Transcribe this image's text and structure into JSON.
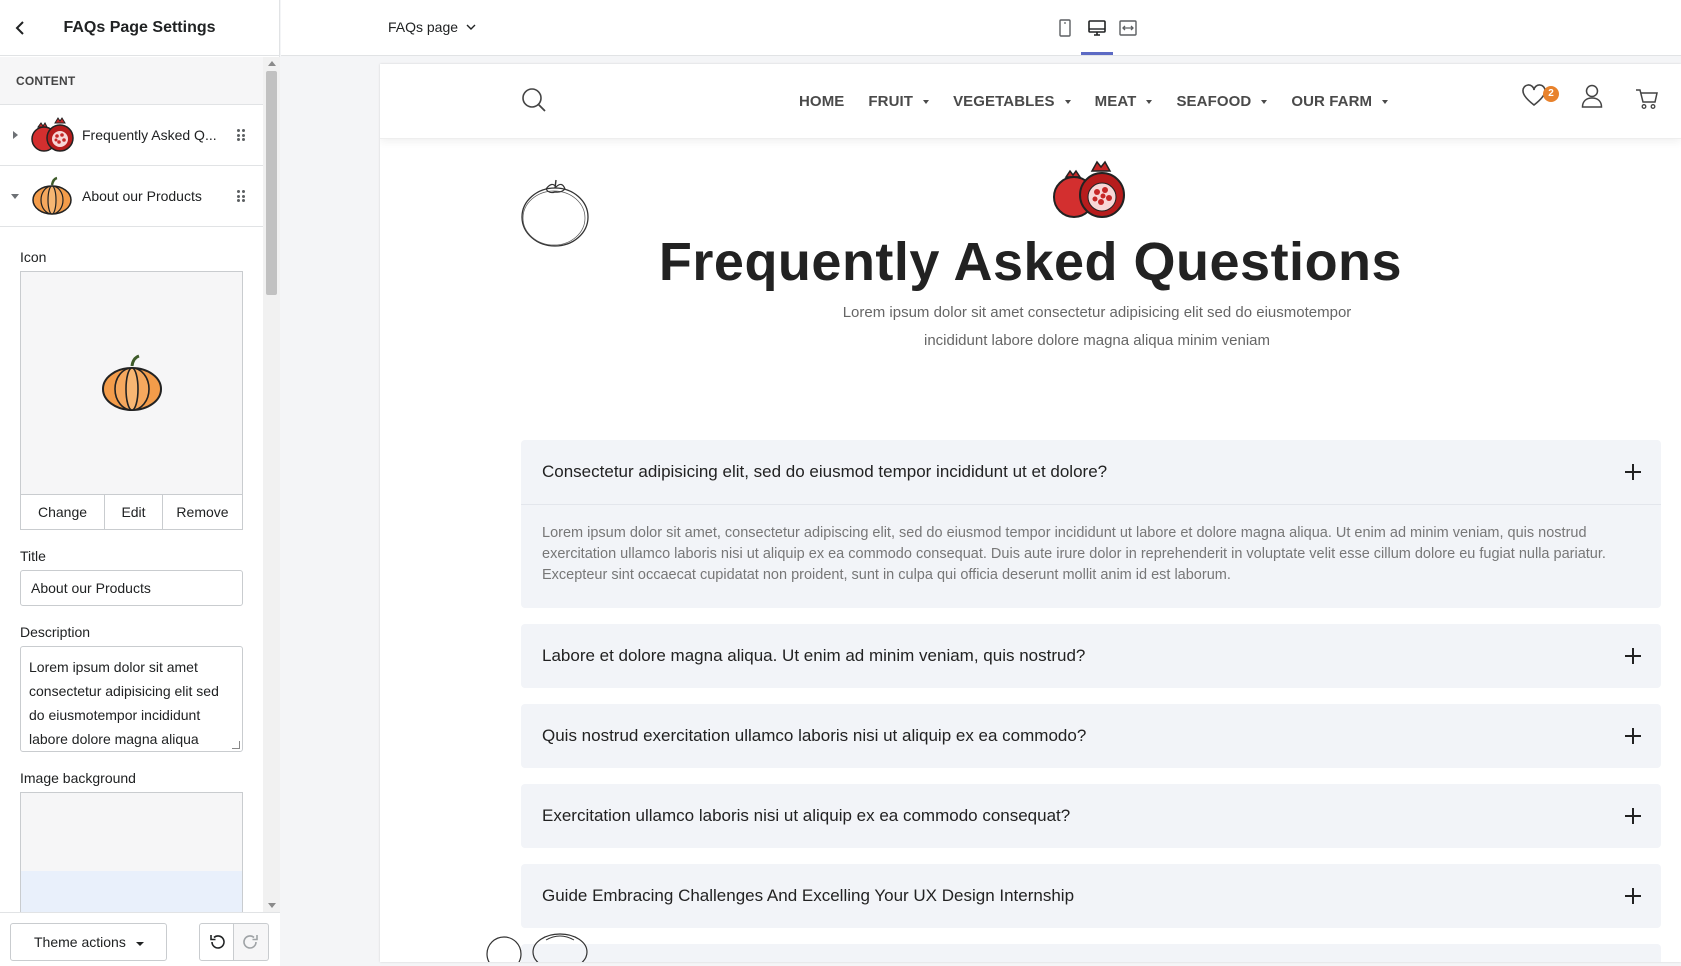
{
  "sidebar": {
    "title": "FAQs Page Settings",
    "section_label": "CONTENT",
    "blocks": [
      {
        "label": "Frequently Asked Q...",
        "icon": "pomegranate-icon",
        "expanded": false
      },
      {
        "label": "About our Products",
        "icon": "pumpkin-icon",
        "expanded": true
      }
    ],
    "icon_label": "Icon",
    "icon_actions": {
      "change": "Change",
      "edit": "Edit",
      "remove": "Remove"
    },
    "title_label": "Title",
    "title_value": "About our Products",
    "description_label": "Description",
    "description_value": "Lorem ipsum dolor sit amet consectetur adipisicing elit sed do eiusmotempor incididunt labore dolore magna aliqua",
    "image_bg_label": "Image background",
    "theme_actions_label": "Theme actions"
  },
  "topbar": {
    "page_selector": "FAQs page",
    "devices": [
      "mobile-icon",
      "desktop-icon",
      "fullwidth-icon"
    ],
    "active_device": "desktop-icon"
  },
  "store": {
    "nav": {
      "items": [
        {
          "label": "HOME",
          "dropdown": false
        },
        {
          "label": "FRUIT",
          "dropdown": true
        },
        {
          "label": "VEGETABLES",
          "dropdown": true
        },
        {
          "label": "MEAT",
          "dropdown": true
        },
        {
          "label": "SEAFOOD",
          "dropdown": true
        },
        {
          "label": "OUR FARM",
          "dropdown": true
        }
      ],
      "wishlist_count": "2"
    },
    "hero": {
      "title": "Frequently Asked Questions",
      "subtitle": "Lorem ipsum dolor sit amet consectetur adipisicing elit sed do eiusmotempor incididunt labore dolore magna aliqua minim veniam"
    },
    "faqs": [
      {
        "question": "Consectetur adipisicing elit, sed do eiusmod tempor incididunt ut et dolore?",
        "answer": "Lorem ipsum dolor sit amet, consectetur adipiscing elit, sed do eiusmod tempor incididunt ut labore et dolore magna aliqua. Ut enim ad minim veniam, quis nostrud exercitation ullamco laboris nisi ut aliquip ex ea commodo consequat. Duis aute irure dolor in reprehenderit in voluptate velit esse cillum dolore eu fugiat nulla pariatur. Excepteur sint occaecat cupidatat non proident, sunt in culpa qui officia deserunt mollit anim id est laborum.",
        "open": true
      },
      {
        "question": "Labore et dolore magna aliqua. Ut enim ad minim veniam, quis nostrud?",
        "open": false
      },
      {
        "question": "Quis nostrud exercitation ullamco laboris nisi ut aliquip ex ea commodo?",
        "open": false
      },
      {
        "question": "Exercitation ullamco laboris nisi ut aliquip ex ea commodo consequat?",
        "open": false
      },
      {
        "question": "Guide Embracing Challenges And Excelling Your UX Design Internship",
        "open": false
      }
    ]
  },
  "colors": {
    "accent": "#5c6ac4",
    "badge": "#e8822c",
    "faq_bg": "#f2f4f8"
  }
}
